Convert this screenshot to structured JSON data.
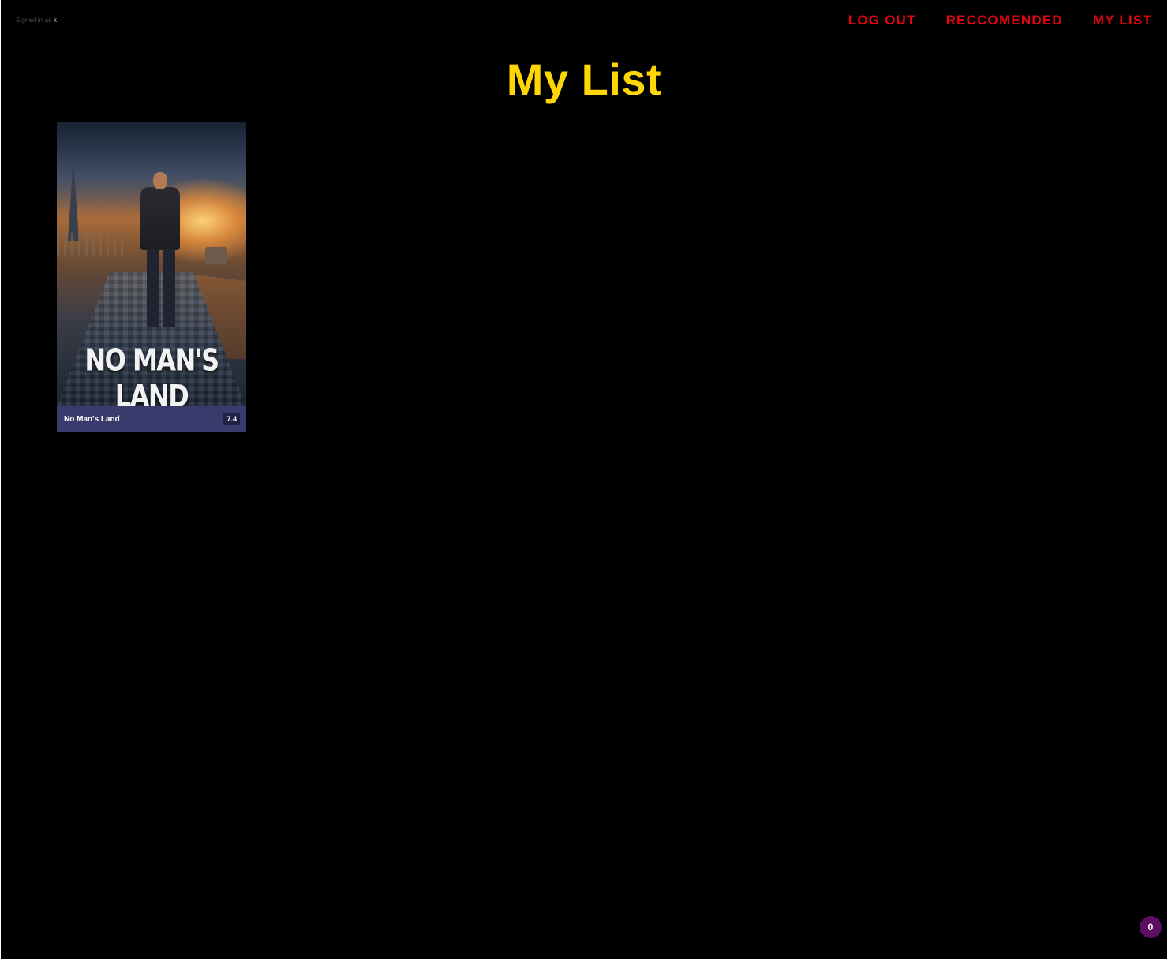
{
  "header": {
    "signed_in_prefix": "Signed in as",
    "username": "k"
  },
  "nav": {
    "items": [
      {
        "label": "LOG OUT"
      },
      {
        "label": "RECCOMENDED"
      },
      {
        "label": "MY LIST"
      }
    ]
  },
  "page": {
    "title": "My List"
  },
  "list": {
    "items": [
      {
        "title": "No Man's Land",
        "rating": "7.4",
        "poster_text": "NO MAN'S LAND"
      }
    ]
  },
  "badge": {
    "count": "0"
  },
  "colors": {
    "background": "#000000",
    "nav_link": "#e0060c",
    "title": "#fed606",
    "card_footer": "#383b6b",
    "badge": "#5b0f62"
  }
}
